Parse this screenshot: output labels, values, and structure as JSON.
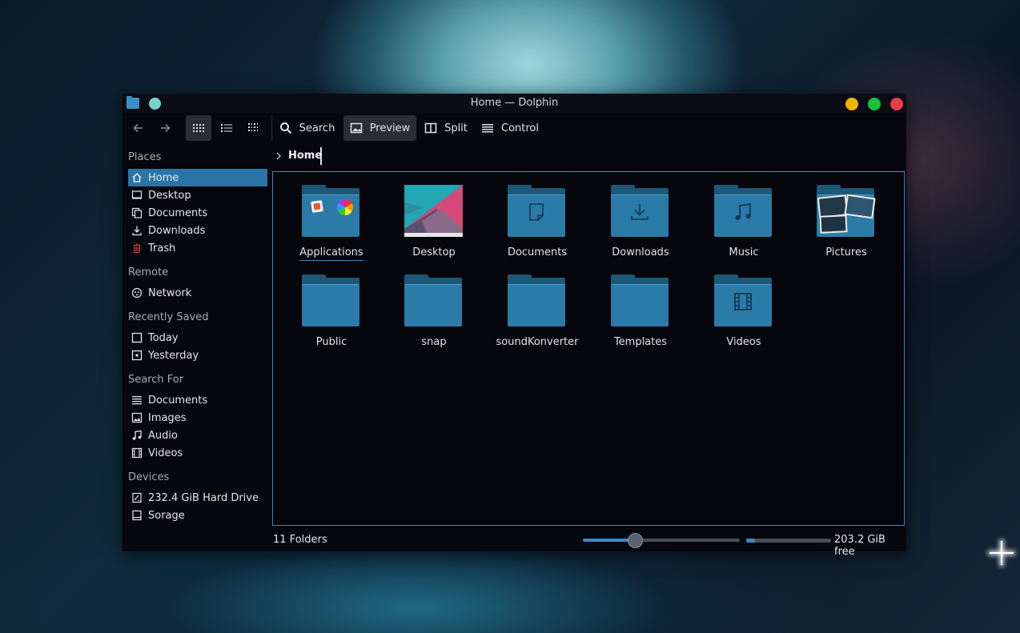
{
  "window": {
    "title": "Home — Dolphin"
  },
  "colors": {
    "accent": "#2a74a8",
    "focus_border": "#3a8ac1",
    "folder": "#2a7ba8",
    "minimize": "#f0b400",
    "maximize": "#17c23a",
    "close": "#e83b4a"
  },
  "toolbar": {
    "back_icon": "arrow-left-icon",
    "forward_icon": "arrow-right-icon",
    "view_modes": [
      "icons-view-icon",
      "details-view-icon",
      "compact-view-icon"
    ],
    "search_label": "Search",
    "preview_label": "Preview",
    "split_label": "Split",
    "control_label": "Control"
  },
  "sidebar": {
    "sections": [
      {
        "title": "Places",
        "items": [
          {
            "label": "Home",
            "icon": "home-icon",
            "selected": true
          },
          {
            "label": "Desktop",
            "icon": "desktop-icon"
          },
          {
            "label": "Documents",
            "icon": "documents-icon"
          },
          {
            "label": "Downloads",
            "icon": "downloads-icon"
          },
          {
            "label": "Trash",
            "icon": "trash-icon"
          }
        ]
      },
      {
        "title": "Remote",
        "items": [
          {
            "label": "Network",
            "icon": "network-icon"
          }
        ]
      },
      {
        "title": "Recently Saved",
        "items": [
          {
            "label": "Today",
            "icon": "calendar-today-icon"
          },
          {
            "label": "Yesterday",
            "icon": "calendar-yesterday-icon"
          }
        ]
      },
      {
        "title": "Search For",
        "items": [
          {
            "label": "Documents",
            "icon": "document-icon"
          },
          {
            "label": "Images",
            "icon": "image-icon"
          },
          {
            "label": "Audio",
            "icon": "audio-icon"
          },
          {
            "label": "Videos",
            "icon": "video-icon"
          }
        ]
      },
      {
        "title": "Devices",
        "items": [
          {
            "label": "232.4 GiB Hard Drive",
            "icon": "hard-drive-icon"
          },
          {
            "label": "Sorage",
            "icon": "storage-drive-icon"
          }
        ]
      }
    ]
  },
  "breadcrumb": {
    "current": "Home"
  },
  "files": [
    {
      "name": "Applications",
      "icon": "applications-folder-icon"
    },
    {
      "name": "Desktop",
      "icon": "desktop-preview-icon"
    },
    {
      "name": "Documents",
      "icon": "documents-folder-icon"
    },
    {
      "name": "Downloads",
      "icon": "downloads-folder-icon"
    },
    {
      "name": "Music",
      "icon": "music-folder-icon"
    },
    {
      "name": "Pictures",
      "icon": "pictures-folder-icon"
    },
    {
      "name": "Public",
      "icon": "folder-icon"
    },
    {
      "name": "snap",
      "icon": "folder-icon"
    },
    {
      "name": "soundKonverter",
      "icon": "folder-icon"
    },
    {
      "name": "Templates",
      "icon": "folder-icon"
    },
    {
      "name": "Videos",
      "icon": "videos-folder-icon"
    }
  ],
  "status": {
    "count": "11 Folders",
    "zoom_fraction": 0.33,
    "used_fraction": 0.1,
    "free": "203.2 GiB free"
  }
}
